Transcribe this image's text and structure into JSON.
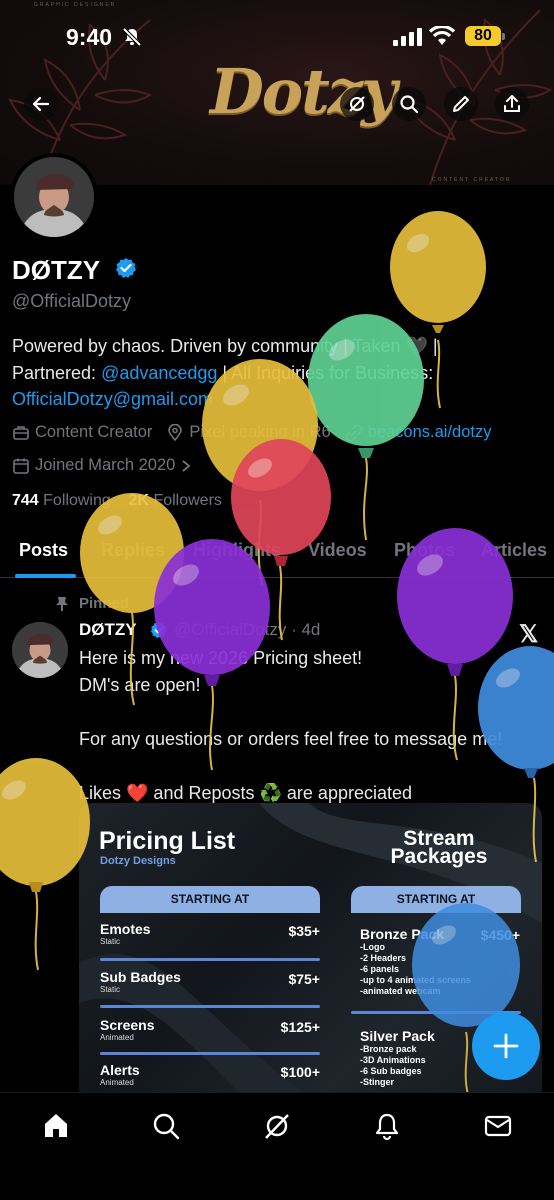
{
  "status_bar": {
    "time": "9:40",
    "battery": "80"
  },
  "banner": {
    "logo_text": "Dotzy",
    "tiny_top": "GRAPHIC DESIGNER",
    "tiny_bottom": "CONTENT CREATOR"
  },
  "profile": {
    "name": "DØTZY",
    "handle": "@OfficialDotzy",
    "bio_line1": "Powered by chaos. Driven by community | Taken 🖤 |",
    "bio_partner_prefix": "Partnered: ",
    "bio_partner_link": "@advancedgg",
    "bio_partner_suffix": " | All Inquiries for Business:",
    "bio_email": "OfficialDotzy@gmail.com",
    "category": "Content Creator",
    "location": "Pixel peaking in R6",
    "website": "beacons.ai/dotzy",
    "joined": "Joined March 2020",
    "following_count": "744",
    "following_label": "Following",
    "followers_count": "2K",
    "followers_label": "Followers"
  },
  "tabs": [
    "Posts",
    "Replies",
    "Highlights",
    "Videos",
    "Photos",
    "Articles"
  ],
  "post": {
    "pinned_label": "Pinned",
    "author_name": "DØTZY",
    "author_handle": "@OfficialDotzy · 4d",
    "line1": "Here is my new 2026 Pricing sheet!",
    "line2": "DM's are open!",
    "line3": "For any questions or orders feel free to message me!",
    "line4": "Likes ❤️ and Reposts ♻️ are appreciated"
  },
  "pricing_image": {
    "title": "Pricing List",
    "subtitle": "Dotzy Designs",
    "title2": "Stream Packages",
    "starting_at": "STARTING AT",
    "items": [
      {
        "name": "Emotes",
        "sub": "Static",
        "price": "$35+"
      },
      {
        "name": "Sub Badges",
        "sub": "Static",
        "price": "$75+"
      },
      {
        "name": "Screens",
        "sub": "Animated",
        "price": "$125+"
      },
      {
        "name": "Alerts",
        "sub": "Animated",
        "price": "$100+"
      }
    ],
    "packs": [
      {
        "name": "Bronze Pack",
        "price": "$450+",
        "features": [
          "-Logo",
          "-2 Headers",
          "-6 panels",
          "-up to 4 animated screens",
          "-animated webcam"
        ]
      },
      {
        "name": "Silver Pack",
        "price": "",
        "features": [
          "-Bronze pack",
          "-3D Animations",
          "-6 Sub badges",
          "-Stinger"
        ]
      }
    ]
  },
  "colors": {
    "accent": "#1d9bf0",
    "balloon_yellow": "#e7be3b",
    "balloon_green": "#5ed193",
    "balloon_red": "#e0455a",
    "balloon_purple": "#8a2fd6",
    "balloon_blue": "#3f8de0"
  }
}
